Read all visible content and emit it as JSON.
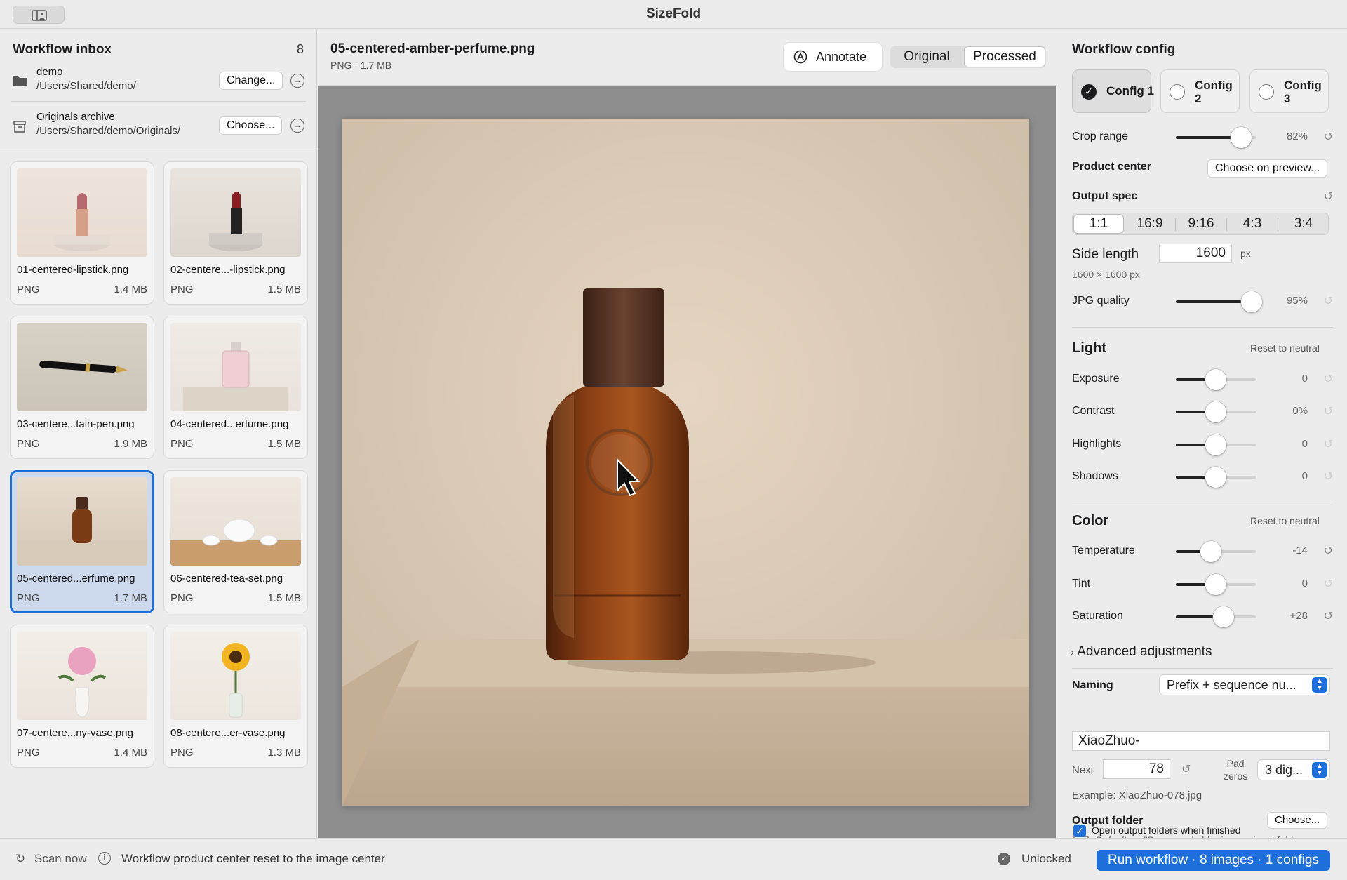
{
  "app": {
    "title": "SizeFold"
  },
  "sidebar": {
    "title": "Workflow inbox",
    "count": "8",
    "input_folder": {
      "name": "demo",
      "path": "/Users/Shared/demo/",
      "button": "Change..."
    },
    "archive_folder": {
      "name": "Originals archive",
      "path": "/Users/Shared/demo/Originals/",
      "button": "Choose..."
    },
    "files": [
      {
        "name": "01-centered-lipstick.png",
        "type": "PNG",
        "size": "1.4 MB"
      },
      {
        "name": "02-centere...-lipstick.png",
        "type": "PNG",
        "size": "1.5 MB"
      },
      {
        "name": "03-centere...tain-pen.png",
        "type": "PNG",
        "size": "1.9 MB"
      },
      {
        "name": "04-centered...erfume.png",
        "type": "PNG",
        "size": "1.5 MB"
      },
      {
        "name": "05-centered...erfume.png",
        "type": "PNG",
        "size": "1.7 MB",
        "selected": true
      },
      {
        "name": "06-centered-tea-set.png",
        "type": "PNG",
        "size": "1.5 MB"
      },
      {
        "name": "07-centere...ny-vase.png",
        "type": "PNG",
        "size": "1.4 MB"
      },
      {
        "name": "08-centere...er-vase.png",
        "type": "PNG",
        "size": "1.3 MB"
      }
    ]
  },
  "preview": {
    "file_name": "05-centered-amber-perfume.png",
    "meta": "PNG · 1.7 MB",
    "annotate_label": "Annotate",
    "view_tabs": [
      "Original",
      "Processed"
    ],
    "active_view": "Processed"
  },
  "config": {
    "title": "Workflow config",
    "tabs": [
      {
        "label": "Config 1",
        "selected": true
      },
      {
        "label": "Config 2",
        "selected": false
      },
      {
        "label": "Config 3",
        "selected": false
      }
    ],
    "crop_range": {
      "label": "Crop range",
      "value": "82%",
      "level": 0.82
    },
    "product_center": {
      "label": "Product center",
      "button": "Choose on preview..."
    },
    "output_spec": {
      "label": "Output spec",
      "ratios": [
        "1:1",
        "16:9",
        "9:16",
        "4:3",
        "3:4"
      ],
      "active_ratio": "1:1",
      "side_length_label": "Side length",
      "side_length": "1600",
      "unit": "px",
      "dimensions": "1600 × 1600 px"
    },
    "jpg_quality": {
      "label": "JPG quality",
      "value": "95%",
      "level": 0.95
    },
    "light": {
      "title": "Light",
      "reset": "Reset to neutral",
      "sliders": [
        {
          "label": "Exposure",
          "value": "0",
          "level": 0.5
        },
        {
          "label": "Contrast",
          "value": "0%",
          "level": 0.5
        },
        {
          "label": "Highlights",
          "value": "0",
          "level": 0.5
        },
        {
          "label": "Shadows",
          "value": "0",
          "level": 0.5
        }
      ]
    },
    "color": {
      "title": "Color",
      "reset": "Reset to neutral",
      "sliders": [
        {
          "label": "Temperature",
          "value": "-14",
          "level": 0.44
        },
        {
          "label": "Tint",
          "value": "0",
          "level": 0.5
        },
        {
          "label": "Saturation",
          "value": "+28",
          "level": 0.6
        }
      ]
    },
    "advanced": "Advanced adjustments",
    "naming": {
      "label": "Naming",
      "mode": "Prefix + sequence nu...",
      "prefix": "XiaoZhuo-",
      "next_label": "Next",
      "next_value": "78",
      "pad_label_1": "Pad",
      "pad_label_2": "zeros",
      "pad_value": "3 dig...",
      "example": "Example: XiaoZhuo-078.jpg"
    },
    "output_folder": {
      "label": "Output folder",
      "button": "Choose...",
      "path": "Default · a \"Processed...lder in your input folder",
      "open_when_finished": "Open output folders when finished",
      "checked": true
    }
  },
  "status": {
    "scan": "Scan now",
    "message": "Workflow product center reset to the image center",
    "license": "Unlocked",
    "run_button": "Run workflow · 8 images · 1 configs"
  },
  "colors": {
    "accent": "#1f6fdb",
    "selection": "#cdd9ec"
  }
}
